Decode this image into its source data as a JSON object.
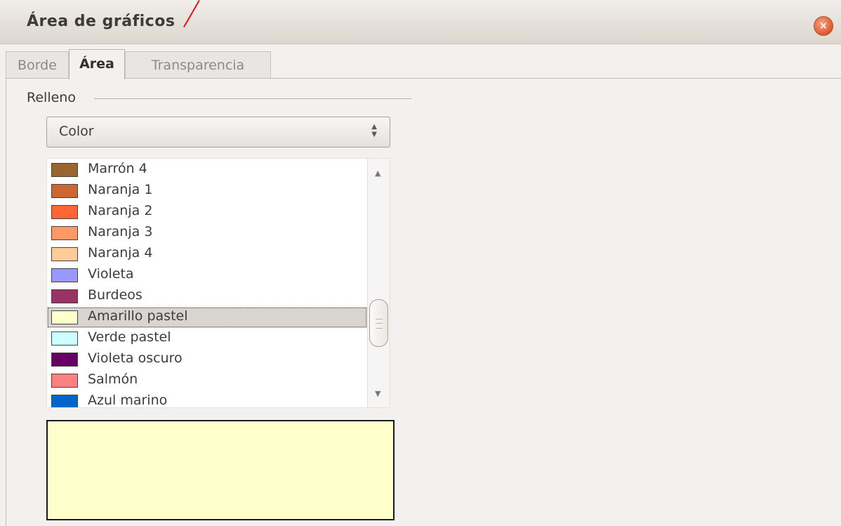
{
  "dialog": {
    "title": "Área de gráficos",
    "close_icon": "close-icon"
  },
  "tabs": [
    {
      "label": "Borde",
      "active": false
    },
    {
      "label": "Área",
      "active": true
    },
    {
      "label": "Transparencia",
      "active": false
    }
  ],
  "fill": {
    "section_label": "Relleno",
    "type_selected": "Color",
    "colors": [
      {
        "name": "Marrón 4",
        "color": "#996633"
      },
      {
        "name": "Naranja 1",
        "color": "#cc6633"
      },
      {
        "name": "Naranja 2",
        "color": "#ff6633"
      },
      {
        "name": "Naranja 3",
        "color": "#ff9966"
      },
      {
        "name": "Naranja 4",
        "color": "#ffcc99"
      },
      {
        "name": "Violeta",
        "color": "#9999ff"
      },
      {
        "name": "Burdeos",
        "color": "#993366"
      },
      {
        "name": "Amarillo pastel",
        "color": "#ffffcc",
        "selected": true
      },
      {
        "name": "Verde pastel",
        "color": "#ccffff"
      },
      {
        "name": "Violeta oscuro",
        "color": "#660066"
      },
      {
        "name": "Salmón",
        "color": "#ff8080"
      },
      {
        "name": "Azul marino",
        "color": "#0066cc"
      }
    ],
    "preview_color": "#ffffcc"
  },
  "accent_colors": {
    "cursor_mark": "#e0141e",
    "close_button": "#e1643a"
  }
}
